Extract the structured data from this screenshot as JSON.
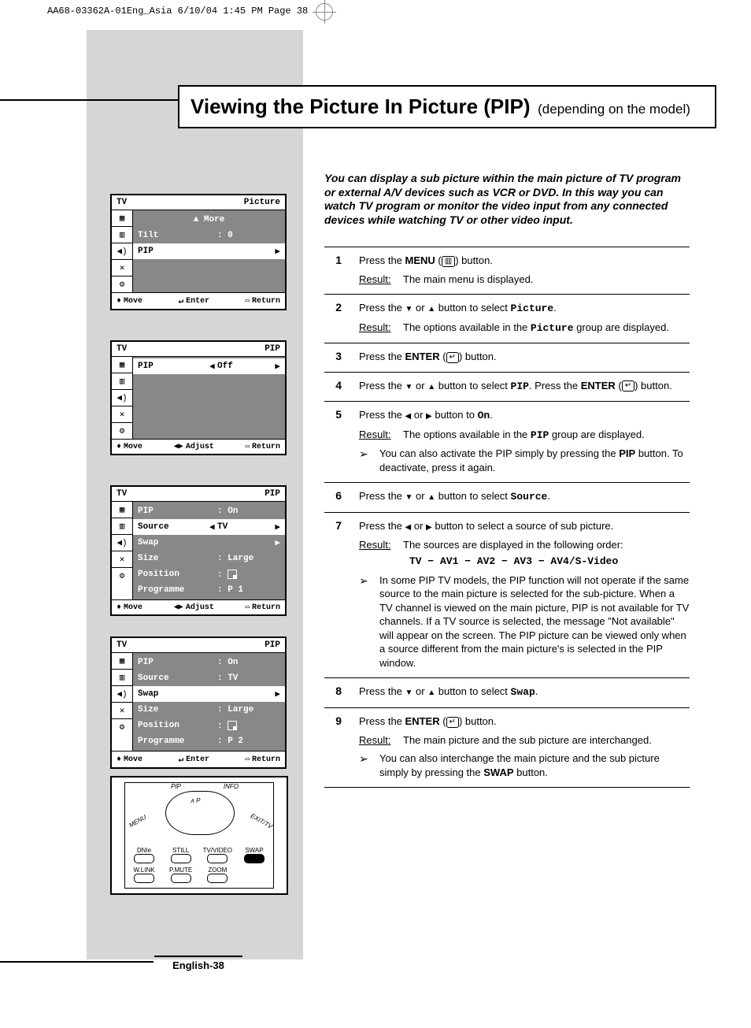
{
  "print_header": "AA68-03362A-01Eng_Asia  6/10/04  1:45 PM  Page 38",
  "title": {
    "main": "Viewing the Picture In Picture (PIP)",
    "sub": "(depending on the model)"
  },
  "intro": "You can display a sub picture within the main picture of TV program or external A/V devices such as VCR or DVD. In this way you can watch TV program or monitor the video input from any connected devices while watching TV or other video input.",
  "steps": {
    "s1": {
      "num": "1",
      "line": {
        "a": "Press the ",
        "b": "MENU",
        "c": " (",
        "d": ") button."
      },
      "result_label": "Result:",
      "result": "The main menu is displayed."
    },
    "s2": {
      "num": "2",
      "line": {
        "a": "Press the ",
        "b": " or ",
        "c": " button to select ",
        "d": "Picture",
        "e": "."
      },
      "result_label": "Result:",
      "result_a": "The options available in the ",
      "result_b": "Picture",
      "result_c": " group are displayed."
    },
    "s3": {
      "num": "3",
      "line": {
        "a": "Press the ",
        "b": "ENTER",
        "c": " (",
        "d": ") button."
      }
    },
    "s4": {
      "num": "4",
      "line": {
        "a": "Press the ",
        "b": " or ",
        "c": " button to select ",
        "d": "PIP",
        "e": ". Press the ",
        "f": "ENTER",
        "g": " (",
        "h": ") button."
      }
    },
    "s5": {
      "num": "5",
      "line": {
        "a": "Press the ",
        "b": " or ",
        "c": " button to ",
        "d": "On",
        "e": "."
      },
      "result_label": "Result:",
      "result_a": "The options available in the ",
      "result_b": "PIP",
      "result_c": " group are displayed.",
      "note_a": "You can also activate the PIP simply by pressing the ",
      "note_b": "PIP",
      "note_c": " button. To deactivate, press it again."
    },
    "s6": {
      "num": "6",
      "line": {
        "a": "Press the ",
        "b": " or ",
        "c": " button to select ",
        "d": "Source",
        "e": "."
      }
    },
    "s7": {
      "num": "7",
      "line": {
        "a": "Press the ",
        "b": " or ",
        "c": " button to select a source of sub picture."
      },
      "result_label": "Result:",
      "result": "The sources are displayed in the following order:",
      "sources": "TV − AV1 − AV2 − AV3 − AV4/S-Video",
      "note": "In some PIP TV models, the PIP function will not operate if the same source to the main picture is selected for the sub-picture. When a TV channel is viewed on the main picture, PIP is not available for TV channels. If a TV source is selected, the message \"Not available\" will appear on the screen. The PIP picture can be viewed only when a source different from the main picture's is selected in the PIP window."
    },
    "s8": {
      "num": "8",
      "line": {
        "a": "Press the ",
        "b": " or ",
        "c": " button to select ",
        "d": "Swap",
        "e": "."
      }
    },
    "s9": {
      "num": "9",
      "line": {
        "a": "Press the ",
        "b": "ENTER",
        "c": " (",
        "d": ") button."
      },
      "result_label": "Result:",
      "result": "The main picture and the sub picture are interchanged.",
      "note_a": "You can also interchange the main picture and the sub picture simply by pressing the ",
      "note_b": "SWAP",
      "note_c": " button."
    }
  },
  "osd": {
    "tv": "TV",
    "move": "Move",
    "enter": "Enter",
    "adjust": "Adjust",
    "return": "Return",
    "menu1": {
      "title": "Picture",
      "more": "More",
      "tilt": "Tilt",
      "tilt_val": ": 0",
      "pip": "PIP"
    },
    "menu2": {
      "title": "PIP",
      "pip": "PIP",
      "off": "Off"
    },
    "menu3": {
      "title": "PIP",
      "pip": "PIP",
      "pip_v": ": On",
      "source": "Source",
      "source_v": "TV",
      "swap": "Swap",
      "size": "Size",
      "size_v": ": Large",
      "position": "Position",
      "programme": "Programme",
      "programme_v": ": P 1"
    },
    "menu4": {
      "title": "PIP",
      "pip": "PIP",
      "pip_v": ": On",
      "source": "Source",
      "source_v": ": TV",
      "swap": "Swap",
      "size": "Size",
      "size_v": ": Large",
      "position": "Position",
      "programme": "Programme",
      "programme_v": ": P 2"
    }
  },
  "remote": {
    "pip": "PIP",
    "info": "INFO",
    "menu": "MENU",
    "exit": "EXIT/TV",
    "p_up": "P",
    "dnie": "DNIe",
    "still": "STILL",
    "tvvideo": "TV/VIDEO",
    "swap": "SWAP",
    "wlink": "W.LINK",
    "pmute": "P.MUTE",
    "zoom": "ZOOM"
  },
  "footer": "English-38"
}
